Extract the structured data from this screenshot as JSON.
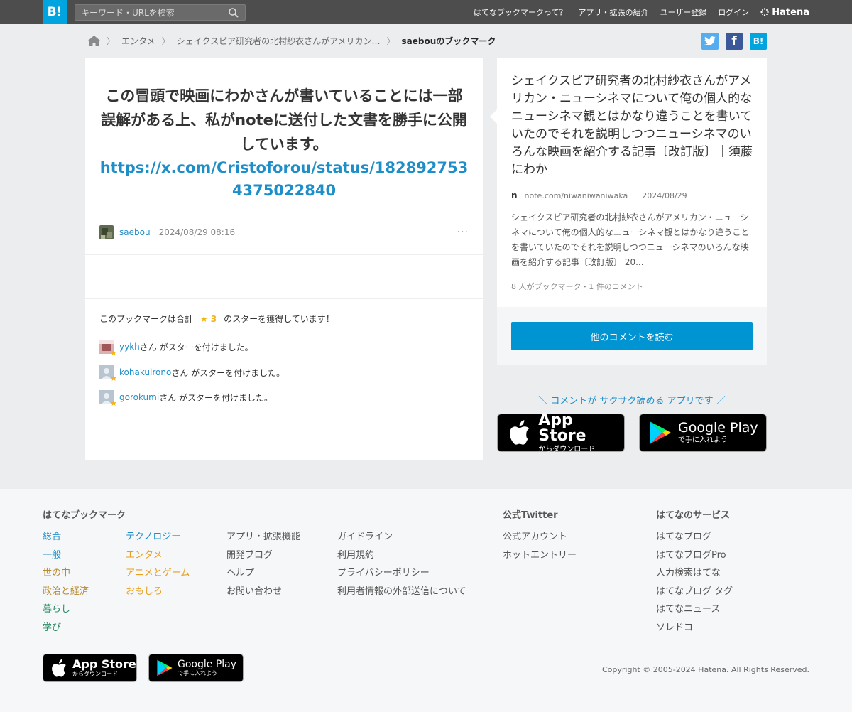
{
  "header": {
    "logo": "B!",
    "search_placeholder": "キーワード・URLを検索",
    "nav": [
      "はてなブックマークって？",
      "アプリ・拡張の紹介",
      "ユーザー登録",
      "ログイン"
    ],
    "brand": "Hatena"
  },
  "breadcrumb": {
    "items": [
      "エンタメ",
      "シェイクスピア研究者の北村紗衣さんがアメリカン…",
      "saebouのブックマーク"
    ]
  },
  "share": {
    "twitter": "t",
    "facebook": "f",
    "hatena": "B!"
  },
  "bookmark": {
    "comment": "この冒頭で映画にわかさんが書いていることには一部誤解がある上、私がnoteに送付した文書を勝手に公開しています。",
    "link": "https://x.com/Cristoforou/status/1828927534375022840",
    "user": "saebou",
    "date": "2024/08/29 08:16",
    "more": "···"
  },
  "stars": {
    "summary_prefix": "このブックマークは合計",
    "star_glyph": "★",
    "count": "3",
    "summary_suffix": "のスターを獲得しています！",
    "rows": [
      {
        "user": "yykh",
        "text": "さん がスターを付けました。"
      },
      {
        "user": "kohakuirono",
        "text": "さん がスターを付けました。"
      },
      {
        "user": "gorokumi",
        "text": "さん がスターを付けました。"
      }
    ]
  },
  "entry": {
    "title": "シェイクスピア研究者の北村紗衣さんがアメリカン・ニューシネマについて俺の個人的なニューシネマ観とはかなり違うことを書いていたのでそれを説明しつつニューシネマのいろんな映画を紹介する記事〔改訂版〕｜須藤にわか",
    "site_icon": "n",
    "domain": "note.com/niwaniwaniwaka",
    "date": "2024/08/29",
    "description": "シェイクスピア研究者の北村紗衣さんがアメリカン・ニューシネマについて俺の個人的なニューシネマ観とはかなり違うことを書いていたのでそれを説明しつつニューシネマのいろんな映画を紹介する記事〔改訂版〕 20...",
    "counts": "8 人がブックマーク・1 件のコメント",
    "read_button": "他のコメントを読む"
  },
  "app_promo": {
    "copy": "＼ コメントが サクサク読める アプリです ／",
    "appstore_big": "App Store",
    "appstore_small": "からダウンロード",
    "googleplay_big": "Google Play",
    "googleplay_small": "で手に入れよう"
  },
  "footer": {
    "col1_heading": "はてなブックマーク",
    "categories_a": [
      "総合",
      "一般",
      "世の中",
      "政治と経済",
      "暮らし",
      "学び"
    ],
    "categories_a_colors": [
      "#1e8ec9",
      "#1e8ec9",
      "#b5872f",
      "#b5872f",
      "#2a8c66",
      "#2a8c66"
    ],
    "categories_b": [
      "テクノロジー",
      "エンタメ",
      "アニメとゲーム",
      "おもしろ"
    ],
    "categories_b_colors": [
      "#1e8ec9",
      "#e89f1d",
      "#e89f1d",
      "#e89f1d"
    ],
    "links_c": [
      "アプリ・拡張機能",
      "開発ブログ",
      "ヘルプ",
      "お問い合わせ"
    ],
    "links_d": [
      "ガイドライン",
      "利用規約",
      "プライバシーポリシー",
      "利用者情報の外部送信について"
    ],
    "twitter_heading": "公式Twitter",
    "twitter_links": [
      "公式アカウント",
      "ホットエントリー"
    ],
    "services_heading": "はてなのサービス",
    "services": [
      "はてなブログ",
      "はてなブログPro",
      "人力検索はてな",
      "はてなブログ タグ",
      "はてなニュース",
      "ソレドコ"
    ],
    "copyright": "Copyright © 2005-2024 Hatena. All Rights Reserved."
  },
  "colors": {
    "brand_blue": "#00a4de",
    "link_blue": "#1e8ec9",
    "star_yellow": "#f2b116",
    "twitter": "#55acee",
    "facebook": "#3b5998"
  }
}
